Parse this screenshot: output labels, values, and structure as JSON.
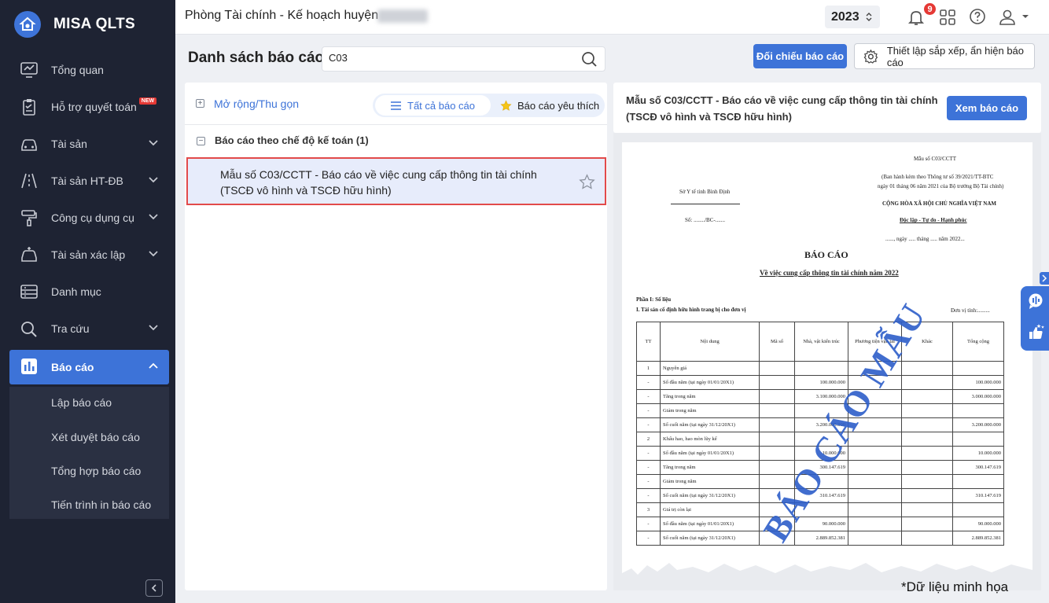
{
  "app": {
    "name": "MISA QLTS"
  },
  "sidebar": {
    "items": [
      {
        "label": "Tổng quan",
        "icon": "monitor-chart-icon"
      },
      {
        "label": "Hỗ trợ quyết toán",
        "icon": "clipboard-check-icon",
        "badge": "NEW"
      },
      {
        "label": "Tài sản",
        "icon": "car-icon"
      },
      {
        "label": "Tài sản HT-ĐB",
        "icon": "road-icon"
      },
      {
        "label": "Công cụ dụng cụ",
        "icon": "paint-roller-icon"
      },
      {
        "label": "Tài sản xác lập",
        "icon": "car-plus-icon"
      },
      {
        "label": "Danh mục",
        "icon": "list-icon"
      },
      {
        "label": "Tra cứu",
        "icon": "search-icon"
      },
      {
        "label": "Báo cáo",
        "icon": "bar-chart-icon"
      }
    ],
    "submenu": [
      "Lập báo cáo",
      "Xét duyệt báo cáo",
      "Tổng hợp báo cáo",
      "Tiến trình in báo cáo"
    ]
  },
  "header": {
    "org": "Phòng Tài chính - Kế hoạch huyện",
    "year": "2023",
    "notifications": "9"
  },
  "toolbar": {
    "title": "Danh sách báo cáo",
    "search_value": "C03",
    "compare_button": "Đối chiếu báo cáo",
    "settings_button": "Thiết lập sắp xếp, ẩn hiện báo cáo"
  },
  "list": {
    "expand_label": "Mở rộng/Thu gọn",
    "tab_all": "Tất cả báo cáo",
    "tab_fav": "Báo cáo yêu thích",
    "group": "Báo cáo theo chế độ kế toán (1)",
    "selected_row": "Mẫu số C03/CCTT - Báo cáo về việc cung cấp thông tin tài chính (TSCĐ vô hình và TSCĐ hữu hình)"
  },
  "preview": {
    "title": "Mẫu số C03/CCTT - Báo cáo về việc cung cấp thông tin tài chính (TSCĐ vô hình và TSCĐ hữu hình)",
    "view_button": "Xem báo cáo",
    "stamp": "BÁO CÁO MẪU",
    "paper": {
      "form_no": "Mẫu số C03/CCTT",
      "issued_1": "(Ban hành kèm theo Thông tư số 39/2021/TT-BTC",
      "issued_2": "ngày 01 tháng 06 năm 2021 của Bộ trưởng Bộ Tài chính)",
      "agency": "Sở Y tế tỉnh Bình Định",
      "number": "Số: ......../BC-.......",
      "country": "CỘNG HÒA XÃ HỘI CHỦ NGHĨA VIỆT NAM",
      "motto": "Độc lập - Tự do - Hạnh phúc",
      "date": "......, ngày ..... tháng ..... năm 2022...",
      "heading": "BÁO CÁO",
      "subheading": "Về việc cung cấp thông tin tài chính năm 2022",
      "part": "Phần I: Số liệu",
      "section": "I. Tài sản cố định hữu hình trang bị cho đơn vị",
      "unit": "Đơn vị tính:.........",
      "columns": [
        "TT",
        "Nội dung",
        "Mã số",
        "Nhà, vật kiến trúc",
        "Phương tiện vận tải",
        "Khác",
        "Tổng cộng"
      ],
      "rows": [
        [
          "1",
          "Nguyên giá",
          "",
          "",
          "",
          "",
          ""
        ],
        [
          "-",
          "Số đầu năm (tại ngày 01/01/20X1)",
          "",
          "100.000.000",
          "",
          "",
          "100.000.000"
        ],
        [
          "-",
          "Tăng trong năm",
          "",
          "3.100.000.000",
          "",
          "",
          "3.000.000.000"
        ],
        [
          "-",
          "Giảm trong năm",
          "",
          "",
          "",
          "",
          ""
        ],
        [
          "-",
          "Số cuối năm (tại ngày 31/12/20X1)",
          "",
          "3.200.000.000",
          "",
          "",
          "3.200.000.000"
        ],
        [
          "2",
          "Khấu hao, hao mòn lũy kế",
          "",
          "",
          "",
          "",
          ""
        ],
        [
          "-",
          "Số đầu năm (tại ngày 01/01/20X1)",
          "",
          "10.000.000",
          "",
          "",
          "10.000.000"
        ],
        [
          "-",
          "Tăng trong năm",
          "",
          "300.147.619",
          "",
          "",
          "300.147.619"
        ],
        [
          "-",
          "Giảm trong năm",
          "",
          "",
          "",
          "",
          ""
        ],
        [
          "-",
          "Số cuối năm (tại ngày 31/12/20X1)",
          "",
          "310.147.619",
          "",
          "",
          "310.147.619"
        ],
        [
          "3",
          "Giá trị còn lại",
          "",
          "",
          "",
          "",
          ""
        ],
        [
          "-",
          "Số đầu năm (tại ngày 01/01/20X1)",
          "",
          "90.000.000",
          "",
          "",
          "90.000.000"
        ],
        [
          "-",
          "Số cuối năm (tại ngày 31/12/20X1)",
          "",
          "2.889.852.381",
          "",
          "",
          "2.889.852.381"
        ]
      ]
    }
  },
  "footnote": "*Dữ liệu minh họa",
  "colors": {
    "accent": "#3d73d8",
    "sidebar": "#1e2333",
    "highlight_border": "#e24a4a"
  }
}
